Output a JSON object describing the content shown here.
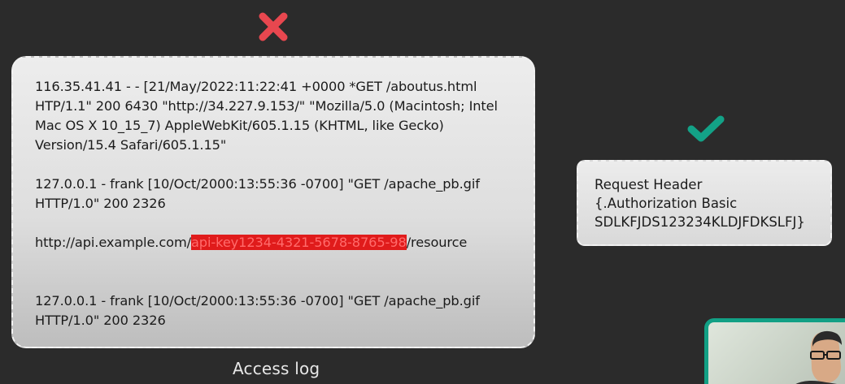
{
  "access_log": {
    "caption": "Access log",
    "entries": [
      {
        "line1": "116.35.41.41 - - [21/May/2022:11:22:41 +0000 *GET /aboutus.html",
        "line2": "HTP/1.1\" 200 6430 \"http://34.227.9.153/\" \"Mozilla/5.0 (Macintosh; Intel",
        "line3": "Mac OS X 10_15_7) AppleWebKit/605.1.15 (KHTML, like Gecko)",
        "line4": "Version/15.4 Safari/605.1.15\""
      },
      {
        "line1": "127.0.0.1 - frank [10/Oct/2000:13:55:36 -0700] \"GET /apache_pb.gif",
        "line2": "HTTP/1.0\" 200 2326"
      },
      {
        "prefix": "http://api.example.com/",
        "highlight": "api-key1234-4321-5678-8765-98",
        "suffix": "/resource"
      },
      {
        "line1": "127.0.0.1 - frank [10/Oct/2000:13:55:36 -0700] \"GET /apache_pb.gif",
        "line2": "HTTP/1.0\" 200 2326"
      }
    ]
  },
  "request_header": {
    "line1": "Request Header",
    "line2": "{.Authorization Basic",
    "line3": "SDLKFJDS123234KLDJFDKSLFJ}"
  },
  "icons": {
    "bad": "x-icon",
    "good": "check-icon",
    "bad_color": "#e8474f",
    "good_color": "#13a287"
  },
  "colors": {
    "background": "#2b2b2b",
    "highlight": "#e01b1b",
    "webcam_border": "#12a085"
  }
}
